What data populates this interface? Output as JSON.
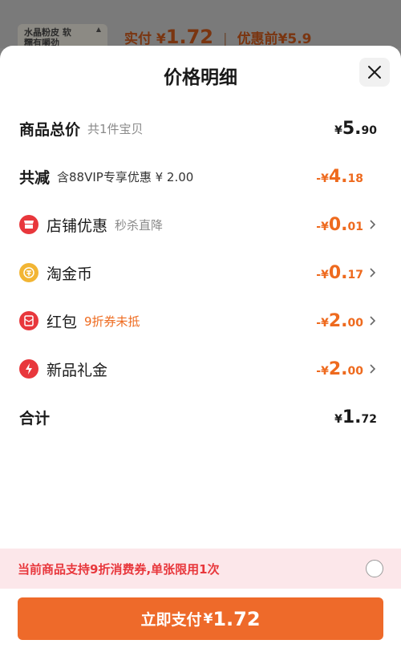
{
  "background": {
    "product_thumb_text": "水晶粉皮 软糯有嚼劲",
    "paid_label": "实付",
    "paid_currency": "¥",
    "paid_amount": "1.72",
    "before_label": "优惠前",
    "before_amount": "¥5.9"
  },
  "sheet": {
    "title": "价格明细",
    "rows": [
      {
        "label": "商品总价",
        "note": "共1件宝贝",
        "sign": "¥",
        "int": "5.",
        "dec": "90",
        "color": "#1a1a1a"
      },
      {
        "label": "共减",
        "note": "含88VIP专享优惠 ¥ 2.00",
        "sign": "-¥",
        "int": "4.",
        "dec": "18",
        "color": "#ee6a1e"
      },
      {
        "label": "店铺优惠",
        "note": "秒杀直降",
        "sign": "-¥",
        "int": "0.",
        "dec": "01",
        "icon": "store-icon",
        "color": "#ee6a1e"
      },
      {
        "label": "淘金币",
        "note": "",
        "sign": "-¥",
        "int": "0.",
        "dec": "17",
        "icon": "gold-coin-icon",
        "color": "#ee6a1e"
      },
      {
        "label": "红包",
        "note": "9折券未抵",
        "sign": "-¥",
        "int": "2.",
        "dec": "00",
        "icon": "red-envelope-icon",
        "color": "#ee6a1e"
      },
      {
        "label": "新品礼金",
        "note": "",
        "sign": "-¥",
        "int": "2.",
        "dec": "00",
        "icon": "lightning-icon",
        "color": "#ee6a1e"
      },
      {
        "label": "合计",
        "note": "",
        "sign": "¥",
        "int": "1.",
        "dec": "72",
        "color": "#1a1a1a"
      }
    ],
    "coupon_text": "当前商品支持9折消费券,单张限用1次",
    "pay_label": "立即支付",
    "pay_currency": "¥",
    "pay_amount": "1.72"
  },
  "colors": {
    "accent": "#ee6a2a",
    "discount": "#ee6a1e",
    "coupon_bg": "#fce7ea",
    "icon_red": "#e8373c",
    "icon_gold": "#f2b534"
  }
}
